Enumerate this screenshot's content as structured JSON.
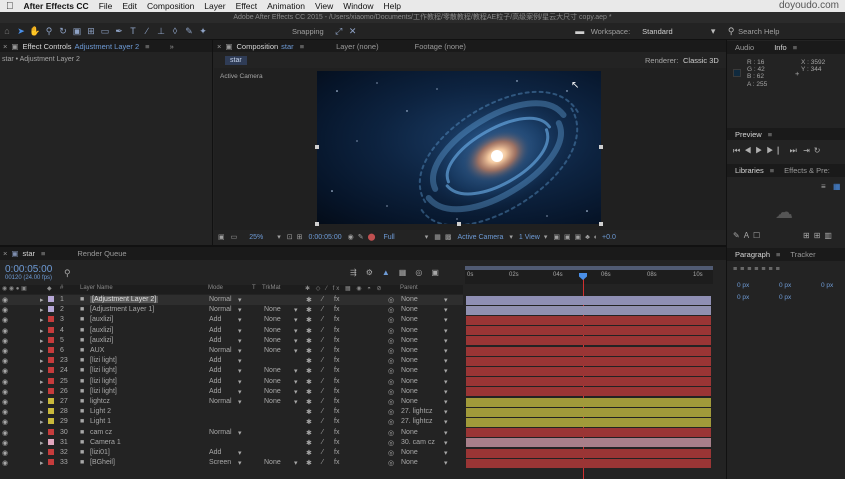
{
  "menubar": {
    "app": "After Effects CC",
    "items": [
      "File",
      "Edit",
      "Composition",
      "Layer",
      "Effect",
      "Animation",
      "View",
      "Window",
      "Help"
    ],
    "watermark": "doyoudo.com"
  },
  "titlebar": {
    "text": "Adobe After Effects CC 2015 - /Users/xiaomo/Documents/工作教程/零散教程/教程AE粒子/高级案例/星云大尺寸 copy.aep *"
  },
  "toolbar": {
    "snapping": "Snapping",
    "workspace_label": "Workspace:",
    "workspace_value": "Standard",
    "search_help": "Search Help"
  },
  "effect_controls": {
    "tab_label": "Effect Controls",
    "layer_name": "Adjustment Layer 2",
    "breadcrumb": "star • Adjustment Layer 2"
  },
  "composition": {
    "tab_prefix": "Composition",
    "comp_name": "star",
    "layer_tab": "Layer (none)",
    "footage_tab": "Footage (none)",
    "flow_tab": "star",
    "renderer_label": "Renderer:",
    "renderer_value": "Classic 3D",
    "active_camera_label": "Active Camera",
    "zoom": "25%",
    "timecode": "0:00:05:00",
    "resolution": "Full",
    "view_camera": "Active Camera",
    "view_layout": "1 View",
    "exposure": "+0.0"
  },
  "timeline": {
    "tab_label": "star",
    "render_queue": "Render Queue",
    "timecode": "0:00:05:00",
    "frame_info": "00120 (24.00 fps)",
    "headers": {
      "num": "#",
      "layer_name": "Layer Name",
      "mode": "Mode",
      "t": "T",
      "trkmat": "TrkMat",
      "parent": "Parent"
    },
    "ruler": [
      "0s",
      "02s",
      "04s",
      "06s",
      "08s",
      "10s"
    ],
    "layers": [
      {
        "num": "1",
        "name": "[Adjustment Layer 2]",
        "mode": "Normal",
        "trkmat": "",
        "parent": "None",
        "swatch": "#b6a7d6",
        "bar": "#8f8fb4",
        "selected": true
      },
      {
        "num": "2",
        "name": "[Adjustment Layer 1]",
        "mode": "Normal",
        "trkmat": "None",
        "parent": "None",
        "swatch": "#b6a7d6",
        "bar": "#9090b0",
        "selected": false
      },
      {
        "num": "3",
        "name": "[auxlizi]",
        "mode": "Add",
        "trkmat": "None",
        "parent": "None",
        "swatch": "#c63c3c",
        "bar": "#9a3535",
        "selected": false
      },
      {
        "num": "4",
        "name": "[auxlizi]",
        "mode": "Add",
        "trkmat": "None",
        "parent": "None",
        "swatch": "#c63c3c",
        "bar": "#9a3535",
        "selected": false
      },
      {
        "num": "5",
        "name": "[auxlizi]",
        "mode": "Add",
        "trkmat": "None",
        "parent": "None",
        "swatch": "#c63c3c",
        "bar": "#9a3535",
        "selected": false
      },
      {
        "num": "6",
        "name": "AUX",
        "mode": "Normal",
        "trkmat": "None",
        "parent": "None",
        "swatch": "#c63c3c",
        "bar": "#9a3535",
        "selected": false
      },
      {
        "num": "23",
        "name": "[lizi light]",
        "mode": "Add",
        "trkmat": "",
        "parent": "None",
        "swatch": "#c63c3c",
        "bar": "#9a3535",
        "selected": false
      },
      {
        "num": "24",
        "name": "[lizi light]",
        "mode": "Add",
        "trkmat": "None",
        "parent": "None",
        "swatch": "#c63c3c",
        "bar": "#9a3535",
        "selected": false
      },
      {
        "num": "25",
        "name": "[lizi light]",
        "mode": "Add",
        "trkmat": "None",
        "parent": "None",
        "swatch": "#c63c3c",
        "bar": "#9a3535",
        "selected": false
      },
      {
        "num": "26",
        "name": "[lizi light]",
        "mode": "Add",
        "trkmat": "None",
        "parent": "None",
        "swatch": "#c63c3c",
        "bar": "#9a3535",
        "selected": false
      },
      {
        "num": "27",
        "name": "lightcz",
        "mode": "Normal",
        "trkmat": "None",
        "parent": "None",
        "swatch": "#c9b93c",
        "bar": "#a19a3a",
        "selected": false
      },
      {
        "num": "28",
        "name": "Light 2",
        "mode": "",
        "trkmat": "",
        "parent": "27. lightcz",
        "swatch": "#c9b93c",
        "bar": "#a19a3a",
        "selected": false
      },
      {
        "num": "29",
        "name": "Light 1",
        "mode": "",
        "trkmat": "",
        "parent": "27. lightcz",
        "swatch": "#c9b93c",
        "bar": "#a19a3a",
        "selected": false
      },
      {
        "num": "30",
        "name": "cam cz",
        "mode": "Normal",
        "trkmat": "",
        "parent": "None",
        "swatch": "#c63c3c",
        "bar": "#9a3535",
        "selected": false
      },
      {
        "num": "31",
        "name": "Camera 1",
        "mode": "",
        "trkmat": "",
        "parent": "30. cam cz",
        "swatch": "#e0a6bd",
        "bar": "#a87f8a",
        "selected": false
      },
      {
        "num": "32",
        "name": "[lizi01]",
        "mode": "Add",
        "trkmat": "",
        "parent": "None",
        "swatch": "#c63c3c",
        "bar": "#9a3535",
        "selected": false
      },
      {
        "num": "33",
        "name": "[BGheil]",
        "mode": "Screen",
        "trkmat": "None",
        "parent": "None",
        "swatch": "#c63c3c",
        "bar": "#9a3535",
        "selected": false
      }
    ]
  },
  "info_panel": {
    "audio_tab": "Audio",
    "info_tab": "Info",
    "r": "R : 16",
    "g": "G : 42",
    "b": "B : 62",
    "a": "A : 255",
    "x": "X : 3592",
    "y": "Y : 344"
  },
  "preview_panel": {
    "label": "Preview"
  },
  "libraries_panel": {
    "libraries_tab": "Libraries",
    "effects_tab": "Effects & Pre:"
  },
  "paragraph_panel": {
    "paragraph_tab": "Paragraph",
    "tracker_tab": "Tracker",
    "px": "0 px"
  }
}
